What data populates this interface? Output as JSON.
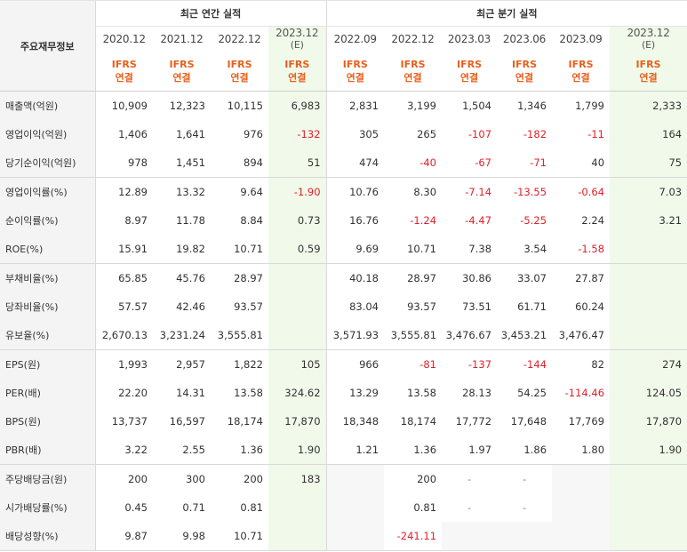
{
  "table": {
    "row_header_label": "주요재무정보",
    "annual_group_label": "최근 연간 실적",
    "quarter_group_label": "최근 분기 실적",
    "annual_periods": [
      {
        "label": "2020.12",
        "sub": "",
        "estimate": false
      },
      {
        "label": "2021.12",
        "sub": "",
        "estimate": false
      },
      {
        "label": "2022.12",
        "sub": "",
        "estimate": false
      },
      {
        "label": "2023.12",
        "sub": "(E)",
        "estimate": true
      }
    ],
    "quarter_periods": [
      {
        "label": "2022.09",
        "sub": "",
        "estimate": false
      },
      {
        "label": "2022.12",
        "sub": "",
        "estimate": false
      },
      {
        "label": "2023.03",
        "sub": "",
        "estimate": false
      },
      {
        "label": "2023.06",
        "sub": "",
        "estimate": false
      },
      {
        "label": "2023.09",
        "sub": "",
        "estimate": false
      },
      {
        "label": "2023.12",
        "sub": "(E)",
        "estimate": true
      }
    ],
    "ifrs_line1": "IFRS",
    "ifrs_line2": "연결",
    "rows": [
      {
        "label": "매출액(억원)",
        "values": [
          "10,909",
          "12,323",
          "10,115",
          "6,983",
          "2,831",
          "3,199",
          "1,504",
          "1,346",
          "1,799",
          "2,333"
        ]
      },
      {
        "label": "영업이익(억원)",
        "values": [
          "1,406",
          "1,641",
          "976",
          "-132",
          "305",
          "265",
          "-107",
          "-182",
          "-11",
          "164"
        ]
      },
      {
        "label": "당기순이익(억원)",
        "values": [
          "978",
          "1,451",
          "894",
          "51",
          "474",
          "-40",
          "-67",
          "-71",
          "40",
          "75"
        ]
      },
      {
        "label": "영업이익률(%)",
        "values": [
          "12.89",
          "13.32",
          "9.64",
          "-1.90",
          "10.76",
          "8.30",
          "-7.14",
          "-13.55",
          "-0.64",
          "7.03"
        ]
      },
      {
        "label": "순이익률(%)",
        "values": [
          "8.97",
          "11.78",
          "8.84",
          "0.73",
          "16.76",
          "-1.24",
          "-4.47",
          "-5.25",
          "2.24",
          "3.21"
        ]
      },
      {
        "label": "ROE(%)",
        "values": [
          "15.91",
          "19.82",
          "10.71",
          "0.59",
          "9.69",
          "10.71",
          "7.38",
          "3.54",
          "-1.58",
          ""
        ]
      },
      {
        "label": "부채비율(%)",
        "values": [
          "65.85",
          "45.76",
          "28.97",
          "",
          "40.18",
          "28.97",
          "30.86",
          "33.07",
          "27.87",
          ""
        ]
      },
      {
        "label": "당좌비율(%)",
        "values": [
          "57.57",
          "42.46",
          "93.57",
          "",
          "83.04",
          "93.57",
          "73.51",
          "61.71",
          "60.24",
          ""
        ]
      },
      {
        "label": "유보율(%)",
        "values": [
          "2,670.13",
          "3,231.24",
          "3,555.81",
          "",
          "3,571.93",
          "3,555.81",
          "3,476.67",
          "3,453.21",
          "3,476.47",
          ""
        ]
      },
      {
        "label": "EPS(원)",
        "values": [
          "1,993",
          "2,957",
          "1,822",
          "105",
          "966",
          "-81",
          "-137",
          "-144",
          "82",
          "274"
        ]
      },
      {
        "label": "PER(배)",
        "values": [
          "22.20",
          "14.31",
          "13.58",
          "324.62",
          "13.29",
          "13.58",
          "28.13",
          "54.25",
          "-114.46",
          "124.05"
        ]
      },
      {
        "label": "BPS(원)",
        "values": [
          "13,737",
          "16,597",
          "18,174",
          "17,870",
          "18,348",
          "18,174",
          "17,772",
          "17,648",
          "17,769",
          "17,870"
        ]
      },
      {
        "label": "PBR(배)",
        "values": [
          "3.22",
          "2.55",
          "1.36",
          "1.90",
          "1.21",
          "1.36",
          "1.97",
          "1.86",
          "1.80",
          "1.90"
        ]
      },
      {
        "label": "주당배당금(원)",
        "values": [
          "200",
          "300",
          "200",
          "183",
          "",
          "200",
          "-",
          "-",
          "",
          ""
        ]
      },
      {
        "label": "시가배당률(%)",
        "values": [
          "0.45",
          "0.71",
          "0.81",
          "",
          "",
          "0.81",
          "-",
          "-",
          "",
          ""
        ]
      },
      {
        "label": "배당성향(%)",
        "values": [
          "9.87",
          "9.98",
          "10.71",
          "",
          "",
          "-241.11",
          "",
          "",
          "",
          ""
        ]
      }
    ]
  }
}
